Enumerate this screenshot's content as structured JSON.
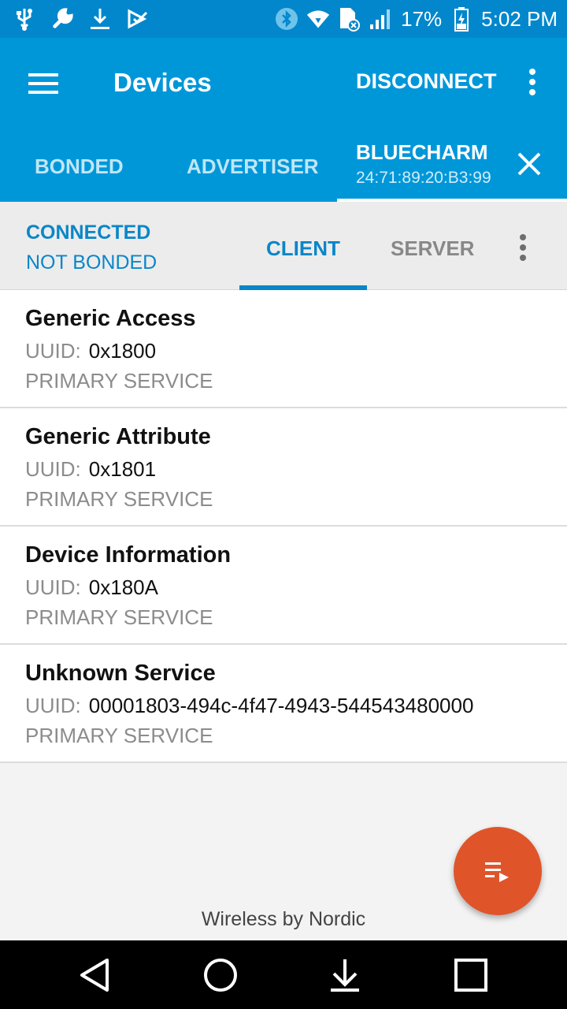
{
  "status_bar": {
    "battery": "17%",
    "time": "5:02 PM",
    "icons": [
      "usb-icon",
      "wrench-icon",
      "download-icon",
      "checkbox-icon",
      "bluetooth-icon",
      "wifi-icon",
      "sim-icon",
      "signal-icon",
      "battery-icon"
    ]
  },
  "app_bar": {
    "title": "Devices",
    "disconnect_label": "DISCONNECT"
  },
  "tabs": {
    "bonded": "BONDED",
    "advertiser": "ADVERTISER",
    "device_name": "BLUECHARM",
    "device_mac": "24:71:89:20:B3:99"
  },
  "sub_bar": {
    "connection_state": "CONNECTED",
    "bond_state": "NOT BONDED",
    "client_tab": "CLIENT",
    "server_tab": "SERVER"
  },
  "services": [
    {
      "name": "Generic Access",
      "uuid_label": "UUID:",
      "uuid": "0x1800",
      "type": "PRIMARY SERVICE"
    },
    {
      "name": "Generic Attribute",
      "uuid_label": "UUID:",
      "uuid": "0x1801",
      "type": "PRIMARY SERVICE"
    },
    {
      "name": "Device Information",
      "uuid_label": "UUID:",
      "uuid": "0x180A",
      "type": "PRIMARY SERVICE"
    },
    {
      "name": "Unknown Service",
      "uuid_label": "UUID:",
      "uuid": "00001803-494c-4f47-4943-544543480000",
      "type": "PRIMARY SERVICE"
    }
  ],
  "footer": {
    "brand": "Wireless by Nordic"
  },
  "colors": {
    "primary": "#0097d9",
    "primary_dark": "#0287cc",
    "accent": "#e0542a"
  }
}
